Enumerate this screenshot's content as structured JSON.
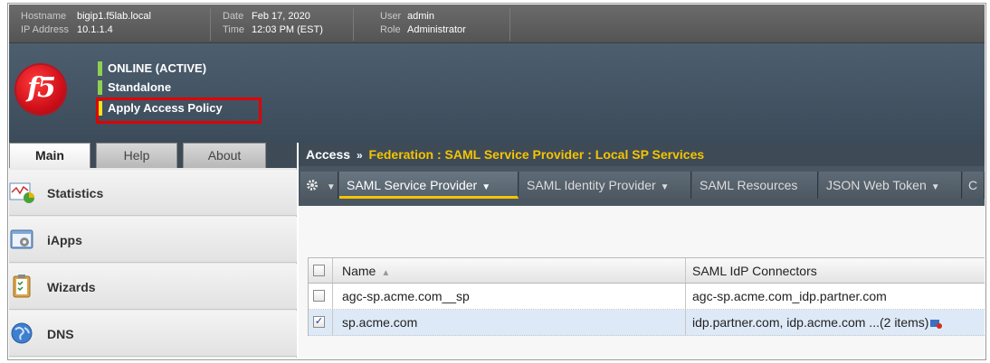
{
  "topbar": {
    "hostname_label": "Hostname",
    "hostname": "bigip1.f5lab.local",
    "ip_label": "IP Address",
    "ip": "10.1.1.4",
    "date_label": "Date",
    "date": "Feb 17, 2020",
    "time_label": "Time",
    "time": "12:03 PM (EST)",
    "user_label": "User",
    "user": "admin",
    "role_label": "Role",
    "role": "Administrator"
  },
  "header": {
    "logo_text": "f5",
    "status_online": "ONLINE (ACTIVE)",
    "status_mode": "Standalone",
    "apply_policy": "Apply Access Policy",
    "colors": {
      "online_bar": "#8fd14f",
      "apply_bar": "#f5e41a",
      "highlight": "#e00000"
    }
  },
  "nav": {
    "tabs": [
      {
        "label": "Main",
        "active": true
      },
      {
        "label": "Help",
        "active": false
      },
      {
        "label": "About",
        "active": false
      }
    ],
    "items": [
      {
        "label": "Statistics",
        "icon": "statistics-chart-icon"
      },
      {
        "label": "iApps",
        "icon": "iapps-gear-icon"
      },
      {
        "label": "Wizards",
        "icon": "wizards-clipboard-icon"
      },
      {
        "label": "DNS",
        "icon": "dns-globe-icon"
      }
    ]
  },
  "breadcrumb": {
    "root": "Access",
    "separator": "»",
    "path": "Federation : SAML Service Provider : Local SP Services"
  },
  "menubar": {
    "gear_icon": "gear-icon",
    "tabs": [
      {
        "label": "SAML Service Provider",
        "active": true,
        "dropdown": true
      },
      {
        "label": "SAML Identity Provider",
        "active": false,
        "dropdown": true
      },
      {
        "label": "SAML Resources",
        "active": false,
        "dropdown": false
      },
      {
        "label": "JSON Web Token",
        "active": false,
        "dropdown": true
      },
      {
        "label": "C",
        "active": false,
        "dropdown": false
      }
    ]
  },
  "table": {
    "columns": [
      "Name",
      "SAML IdP Connectors"
    ],
    "sort_indicator": "▲",
    "rows": [
      {
        "name": "agc-sp.acme.com__sp",
        "connectors": "agc-sp.acme.com_idp.partner.com",
        "checked": false
      },
      {
        "name": "sp.acme.com",
        "connectors": "idp.partner.com, idp.acme.com ...(2 items)",
        "checked": true
      }
    ]
  }
}
